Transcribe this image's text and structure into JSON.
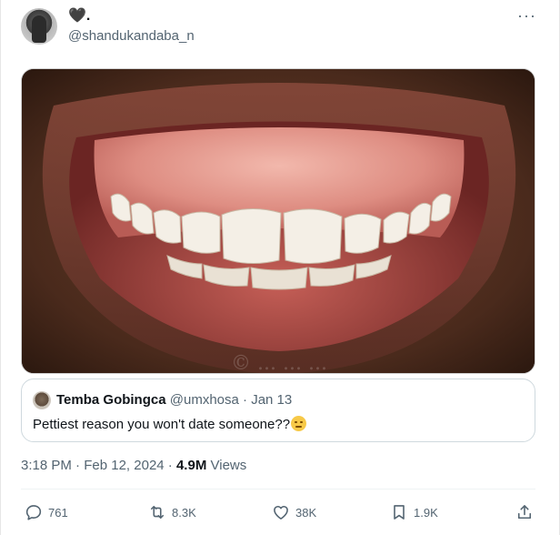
{
  "tweet": {
    "author": {
      "display_name": "🖤.",
      "handle": "@shandukandaba_n"
    },
    "more_icon": "more-horizontal-icon",
    "media": {
      "watermark": "© ... ... ..."
    },
    "quoted": {
      "display_name": "Temba Gobingca",
      "handle": "@umxhosa",
      "separator": "·",
      "date": "Jan 13",
      "text": "Pettiest reason you won't date someone??",
      "emoji": "unamused-face"
    },
    "meta": {
      "time": "3:18 PM",
      "date": "Feb 12, 2024",
      "views_count": "4.9M",
      "views_label": "Views",
      "sep1": "·",
      "sep2": "·"
    },
    "actions": {
      "reply": "761",
      "retweet": "8.3K",
      "like": "38K",
      "bookmark": "1.9K"
    }
  },
  "colors": {
    "text_primary": "#0f1419",
    "text_secondary": "#536471",
    "border": "#cfd9de"
  }
}
